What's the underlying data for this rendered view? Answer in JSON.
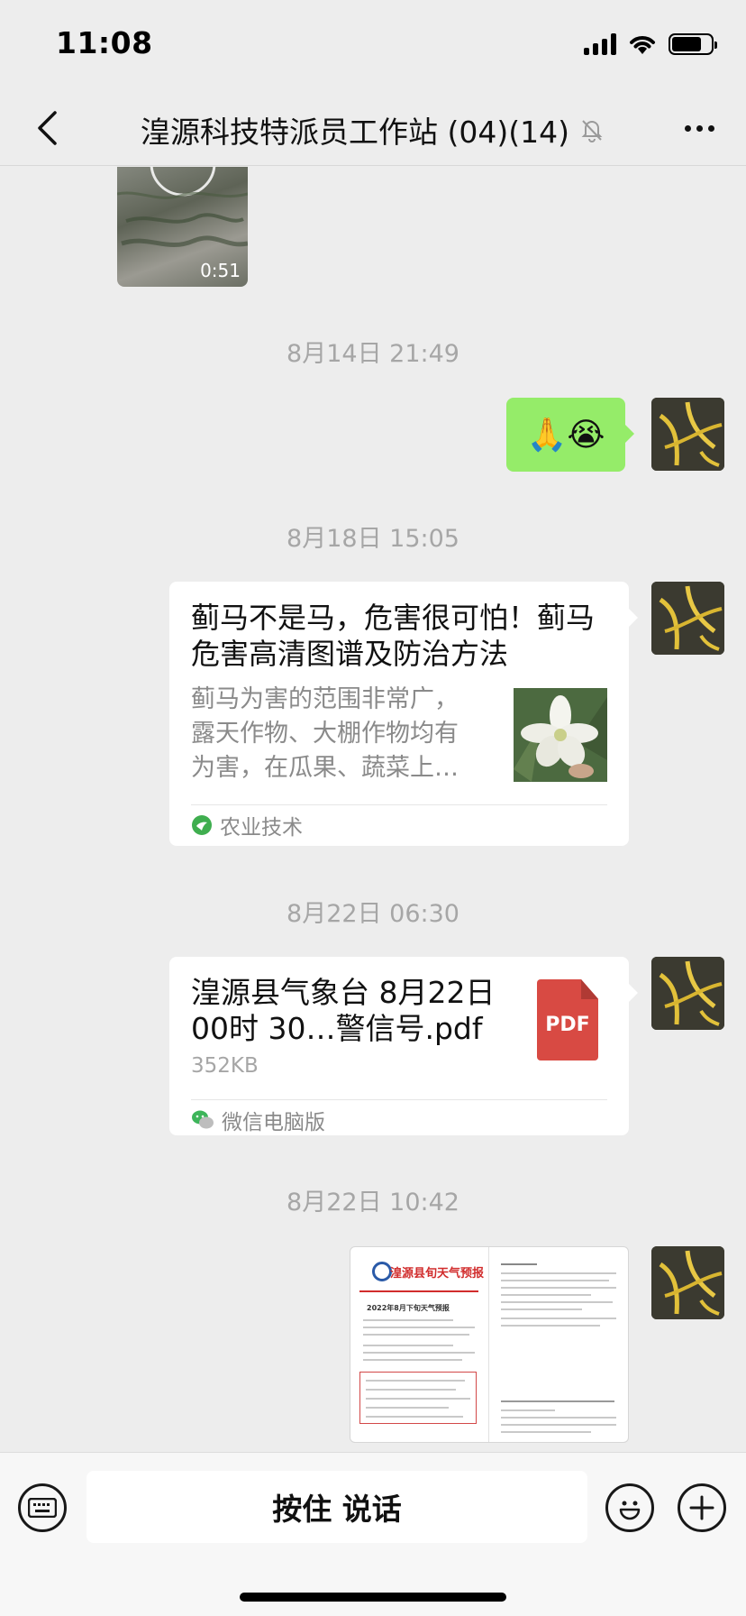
{
  "status_bar": {
    "time": "11:08"
  },
  "header": {
    "title": "湟源科技特派员工作站 (04)(14)"
  },
  "messages": {
    "video": {
      "duration": "0:51"
    },
    "ts1": "8月14日 21:49",
    "emoji_message": "🙏😭",
    "ts2": "8月18日 15:05",
    "article": {
      "title": "蓟马不是马，危害很可怕！蓟马危害高清图谱及防治方法",
      "description": "蓟马为害的范围非常广，露天作物、大棚作物均有为害，在瓜果、蔬菜上…",
      "source": "农业技术"
    },
    "ts3": "8月22日 06:30",
    "file": {
      "name": "湟源县气象台 8月22日00时 30…警信号.pdf",
      "size": "352KB",
      "type_label": "PDF",
      "source": "微信电脑版"
    },
    "ts4": "8月22日 10:42",
    "image_doc": {
      "title": "湟源县旬天气预报",
      "subtitle": "2022年8月下旬天气预报"
    }
  },
  "input_bar": {
    "hold_to_talk": "按住 说话"
  },
  "icons": [
    "back-icon",
    "mute-bell-icon",
    "more-icon",
    "play-icon",
    "wechat-icon",
    "keyboard-icon",
    "emoji-icon",
    "plus-icon"
  ]
}
